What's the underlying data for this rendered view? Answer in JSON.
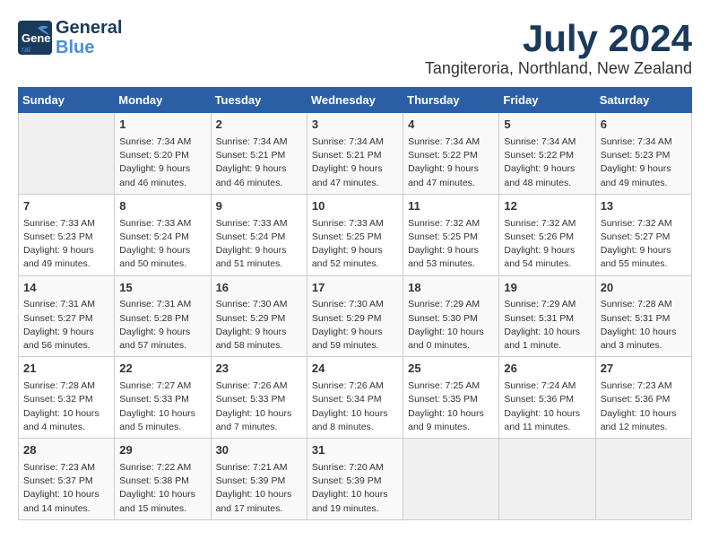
{
  "logo": {
    "line1": "General",
    "line2": "Blue"
  },
  "title": "July 2024",
  "subtitle": "Tangiteroria, Northland, New Zealand",
  "days_of_week": [
    "Sunday",
    "Monday",
    "Tuesday",
    "Wednesday",
    "Thursday",
    "Friday",
    "Saturday"
  ],
  "weeks": [
    [
      {
        "num": "",
        "info": ""
      },
      {
        "num": "1",
        "info": "Sunrise: 7:34 AM\nSunset: 5:20 PM\nDaylight: 9 hours\nand 46 minutes."
      },
      {
        "num": "2",
        "info": "Sunrise: 7:34 AM\nSunset: 5:21 PM\nDaylight: 9 hours\nand 46 minutes."
      },
      {
        "num": "3",
        "info": "Sunrise: 7:34 AM\nSunset: 5:21 PM\nDaylight: 9 hours\nand 47 minutes."
      },
      {
        "num": "4",
        "info": "Sunrise: 7:34 AM\nSunset: 5:22 PM\nDaylight: 9 hours\nand 47 minutes."
      },
      {
        "num": "5",
        "info": "Sunrise: 7:34 AM\nSunset: 5:22 PM\nDaylight: 9 hours\nand 48 minutes."
      },
      {
        "num": "6",
        "info": "Sunrise: 7:34 AM\nSunset: 5:23 PM\nDaylight: 9 hours\nand 49 minutes."
      }
    ],
    [
      {
        "num": "7",
        "info": "Sunrise: 7:33 AM\nSunset: 5:23 PM\nDaylight: 9 hours\nand 49 minutes."
      },
      {
        "num": "8",
        "info": "Sunrise: 7:33 AM\nSunset: 5:24 PM\nDaylight: 9 hours\nand 50 minutes."
      },
      {
        "num": "9",
        "info": "Sunrise: 7:33 AM\nSunset: 5:24 PM\nDaylight: 9 hours\nand 51 minutes."
      },
      {
        "num": "10",
        "info": "Sunrise: 7:33 AM\nSunset: 5:25 PM\nDaylight: 9 hours\nand 52 minutes."
      },
      {
        "num": "11",
        "info": "Sunrise: 7:32 AM\nSunset: 5:25 PM\nDaylight: 9 hours\nand 53 minutes."
      },
      {
        "num": "12",
        "info": "Sunrise: 7:32 AM\nSunset: 5:26 PM\nDaylight: 9 hours\nand 54 minutes."
      },
      {
        "num": "13",
        "info": "Sunrise: 7:32 AM\nSunset: 5:27 PM\nDaylight: 9 hours\nand 55 minutes."
      }
    ],
    [
      {
        "num": "14",
        "info": "Sunrise: 7:31 AM\nSunset: 5:27 PM\nDaylight: 9 hours\nand 56 minutes."
      },
      {
        "num": "15",
        "info": "Sunrise: 7:31 AM\nSunset: 5:28 PM\nDaylight: 9 hours\nand 57 minutes."
      },
      {
        "num": "16",
        "info": "Sunrise: 7:30 AM\nSunset: 5:29 PM\nDaylight: 9 hours\nand 58 minutes."
      },
      {
        "num": "17",
        "info": "Sunrise: 7:30 AM\nSunset: 5:29 PM\nDaylight: 9 hours\nand 59 minutes."
      },
      {
        "num": "18",
        "info": "Sunrise: 7:29 AM\nSunset: 5:30 PM\nDaylight: 10 hours\nand 0 minutes."
      },
      {
        "num": "19",
        "info": "Sunrise: 7:29 AM\nSunset: 5:31 PM\nDaylight: 10 hours\nand 1 minute."
      },
      {
        "num": "20",
        "info": "Sunrise: 7:28 AM\nSunset: 5:31 PM\nDaylight: 10 hours\nand 3 minutes."
      }
    ],
    [
      {
        "num": "21",
        "info": "Sunrise: 7:28 AM\nSunset: 5:32 PM\nDaylight: 10 hours\nand 4 minutes."
      },
      {
        "num": "22",
        "info": "Sunrise: 7:27 AM\nSunset: 5:33 PM\nDaylight: 10 hours\nand 5 minutes."
      },
      {
        "num": "23",
        "info": "Sunrise: 7:26 AM\nSunset: 5:33 PM\nDaylight: 10 hours\nand 7 minutes."
      },
      {
        "num": "24",
        "info": "Sunrise: 7:26 AM\nSunset: 5:34 PM\nDaylight: 10 hours\nand 8 minutes."
      },
      {
        "num": "25",
        "info": "Sunrise: 7:25 AM\nSunset: 5:35 PM\nDaylight: 10 hours\nand 9 minutes."
      },
      {
        "num": "26",
        "info": "Sunrise: 7:24 AM\nSunset: 5:36 PM\nDaylight: 10 hours\nand 11 minutes."
      },
      {
        "num": "27",
        "info": "Sunrise: 7:23 AM\nSunset: 5:36 PM\nDaylight: 10 hours\nand 12 minutes."
      }
    ],
    [
      {
        "num": "28",
        "info": "Sunrise: 7:23 AM\nSunset: 5:37 PM\nDaylight: 10 hours\nand 14 minutes."
      },
      {
        "num": "29",
        "info": "Sunrise: 7:22 AM\nSunset: 5:38 PM\nDaylight: 10 hours\nand 15 minutes."
      },
      {
        "num": "30",
        "info": "Sunrise: 7:21 AM\nSunset: 5:39 PM\nDaylight: 10 hours\nand 17 minutes."
      },
      {
        "num": "31",
        "info": "Sunrise: 7:20 AM\nSunset: 5:39 PM\nDaylight: 10 hours\nand 19 minutes."
      },
      {
        "num": "",
        "info": ""
      },
      {
        "num": "",
        "info": ""
      },
      {
        "num": "",
        "info": ""
      }
    ]
  ]
}
